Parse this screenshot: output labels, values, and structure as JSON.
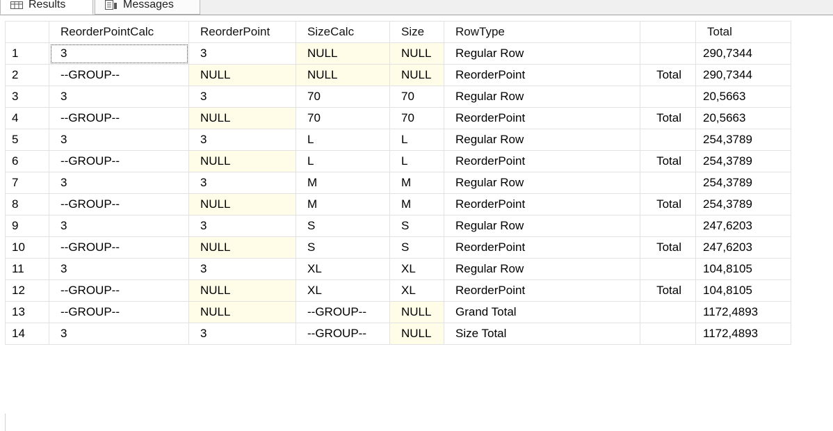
{
  "tabs": {
    "results_label": "Results",
    "messages_label": "Messages",
    "results_icon": "grid-icon",
    "messages_icon": "messages-icon"
  },
  "columns": [
    "",
    "ReorderPointCalc",
    "ReorderPoint",
    "SizeCalc",
    "Size",
    "RowType",
    "",
    "Total"
  ],
  "rows": [
    [
      "1",
      "3",
      "3",
      "NULL",
      "NULL",
      "Regular Row",
      "",
      "290,7344"
    ],
    [
      "2",
      "--GROUP--",
      "NULL",
      "NULL",
      "NULL",
      "ReorderPoint",
      "Total",
      "290,7344"
    ],
    [
      "3",
      "3",
      "3",
      "70",
      "70",
      "Regular Row",
      "",
      "20,5663"
    ],
    [
      "4",
      "--GROUP--",
      "NULL",
      "70",
      "70",
      "ReorderPoint",
      "Total",
      "20,5663"
    ],
    [
      "5",
      "3",
      "3",
      "L",
      "L",
      "Regular Row",
      "",
      "254,3789"
    ],
    [
      "6",
      "--GROUP--",
      "NULL",
      "L",
      "L",
      "ReorderPoint",
      "Total",
      "254,3789"
    ],
    [
      "7",
      "3",
      "3",
      "M",
      "M",
      "Regular Row",
      "",
      "254,3789"
    ],
    [
      "8",
      "--GROUP--",
      "NULL",
      "M",
      "M",
      "ReorderPoint",
      "Total",
      "254,3789"
    ],
    [
      "9",
      "3",
      "3",
      "S",
      "S",
      "Regular Row",
      "",
      "247,6203"
    ],
    [
      "10",
      "--GROUP--",
      "NULL",
      "S",
      "S",
      "ReorderPoint",
      "Total",
      "247,6203"
    ],
    [
      "11",
      "3",
      "3",
      "XL",
      "XL",
      "Regular Row",
      "",
      "104,8105"
    ],
    [
      "12",
      "--GROUP--",
      "NULL",
      "XL",
      "XL",
      "ReorderPoint",
      "Total",
      "104,8105"
    ],
    [
      "13",
      "--GROUP--",
      "NULL",
      "--GROUP--",
      "NULL",
      "Grand Total",
      "",
      "1172,4893"
    ],
    [
      "14",
      "3",
      "3",
      "--GROUP--",
      "NULL",
      "Size Total",
      "",
      "1172,4893"
    ]
  ],
  "colors": {
    "null_cell_bg": "#fffde7",
    "grid_line": "#e2e2e2",
    "tab_bar_bg": "#f0f0f0"
  }
}
